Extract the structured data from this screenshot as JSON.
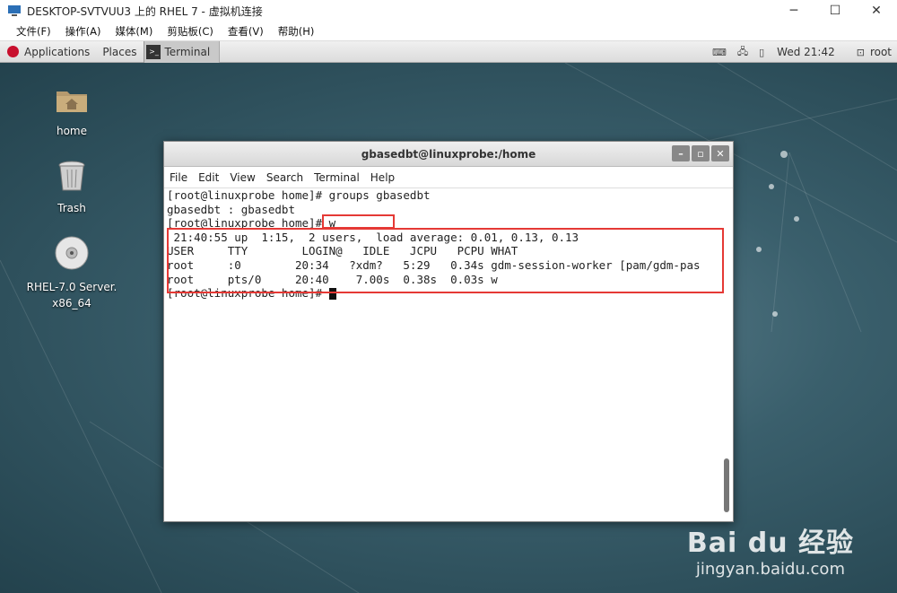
{
  "host": {
    "title": "DESKTOP-SVTVUU3 上的 RHEL 7 - 虚拟机连接",
    "menu": [
      "文件(F)",
      "操作(A)",
      "媒体(M)",
      "剪贴板(C)",
      "查看(V)",
      "帮助(H)"
    ],
    "controls": {
      "minimize": "─",
      "maximize": "☐",
      "close": "✕"
    }
  },
  "gnome": {
    "applications": "Applications",
    "places": "Places",
    "task": "Terminal",
    "clock": "Wed 21:42",
    "user": "root"
  },
  "desktop": {
    "icons": [
      {
        "label": "home"
      },
      {
        "label": "Trash"
      },
      {
        "label": "RHEL-7.0 Server.\nx86_64"
      }
    ]
  },
  "terminal": {
    "title": "gbasedbt@linuxprobe:/home",
    "menu": [
      "File",
      "Edit",
      "View",
      "Search",
      "Terminal",
      "Help"
    ],
    "lines": [
      "[root@linuxprobe home]# groups gbasedbt",
      "gbasedbt : gbasedbt",
      "[root@linuxprobe home]# w",
      " 21:40:55 up  1:15,  2 users,  load average: 0.01, 0.13, 0.13",
      "USER     TTY        LOGIN@   IDLE   JCPU   PCPU WHAT",
      "root     :0        20:34   ?xdm?   5:29   0.34s gdm-session-worker [pam/gdm-pas",
      "root     pts/0     20:40    7.00s  0.38s  0.03s w",
      "[root@linuxprobe home]# "
    ]
  },
  "watermark": {
    "logo": "Bai du 经验",
    "site": "jingyan.baidu.com"
  },
  "colors": {
    "highlight": "#e53935",
    "redhat": "#c8102e"
  }
}
